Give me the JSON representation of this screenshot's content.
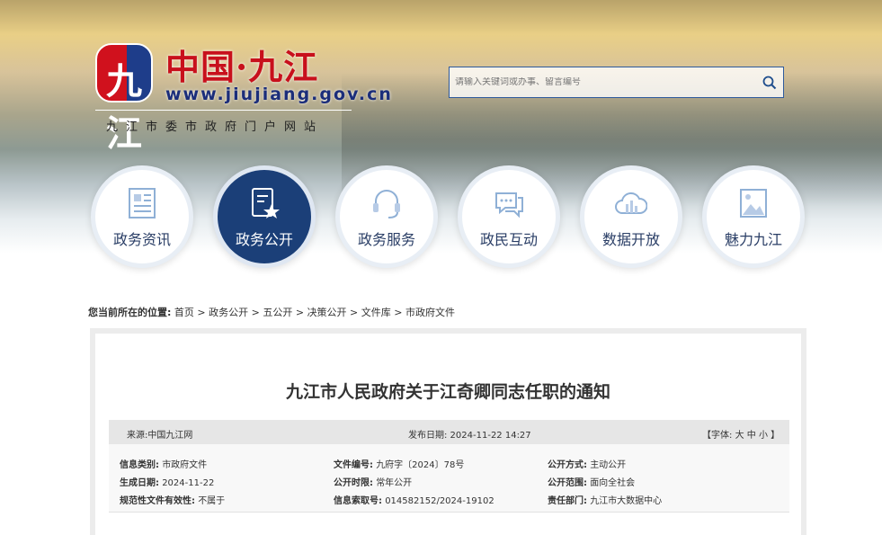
{
  "header": {
    "logo_text": "九江",
    "site_name": "中国·九江",
    "site_url": "www.jiujiang.gov.cn",
    "site_subtitle": "九江市委市政府门户网站",
    "search": {
      "placeholder": "请输入关键词或办事、留言编号"
    }
  },
  "nav": [
    {
      "label": "政务资讯",
      "icon": "newspaper-icon"
    },
    {
      "label": "政务公开",
      "icon": "document-star-icon",
      "active": true
    },
    {
      "label": "政务服务",
      "icon": "headset-icon"
    },
    {
      "label": "政民互动",
      "icon": "chat-icon"
    },
    {
      "label": "数据开放",
      "icon": "cloud-chart-icon"
    },
    {
      "label": "魅力九江",
      "icon": "image-icon"
    }
  ],
  "breadcrumb": {
    "label": "您当前所在的位置:",
    "items": [
      "首页",
      "政务公开",
      "五公开",
      "决策公开",
      "文件库",
      "市政府文件"
    ]
  },
  "article": {
    "title": "九江市人民政府关于江奇卿同志任职的通知",
    "source": "来源:中国九江网",
    "publish_date": "发布日期:  2024-11-22 14:27",
    "font_size": {
      "open": "【字体:",
      "large": "大",
      "medium": "中",
      "small": "小",
      "close": "】"
    },
    "info": [
      {
        "k": "信息类别:",
        "v": "市政府文件"
      },
      {
        "k": "文件编号:",
        "v": "九府字〔2024〕78号"
      },
      {
        "k": "公开方式:",
        "v": "主动公开"
      },
      {
        "k": "生成日期:",
        "v": "2024-11-22"
      },
      {
        "k": "公开时限:",
        "v": "常年公开"
      },
      {
        "k": "公开范围:",
        "v": "面向全社会"
      },
      {
        "k": "规范性文件有效性:",
        "v": "不属于"
      },
      {
        "k": "信息索取号:",
        "v": "014582152/2024-19102"
      },
      {
        "k": "责任部门:",
        "v": "九江市大数据中心"
      }
    ]
  }
}
